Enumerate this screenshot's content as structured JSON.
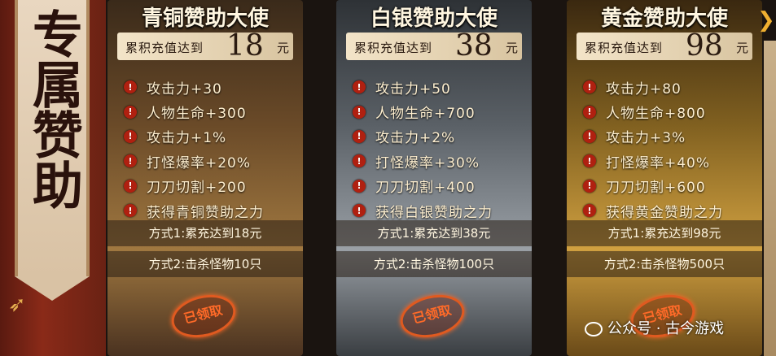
{
  "banner": {
    "title": "专属赞助"
  },
  "cards": [
    {
      "title": "青铜赞助大使",
      "price_label": "累积充值达到",
      "price_value": "18",
      "price_unit": "元",
      "perks": [
        "攻击力+30",
        "人物生命+300",
        "攻击力+1%",
        "打怪爆率+20%",
        "刀刀切割+200",
        "获得青铜赞助之力"
      ],
      "method1": "方式1:累充达到18元",
      "method2": "方式2:击杀怪物10只",
      "stamp": "已领取"
    },
    {
      "title": "白银赞助大使",
      "price_label": "累积充值达到",
      "price_value": "38",
      "price_unit": "元",
      "perks": [
        "攻击力+50",
        "人物生命+700",
        "攻击力+2%",
        "打怪爆率+30%",
        "刀刀切割+400",
        "获得白银赞助之力"
      ],
      "method1": "方式1:累充达到38元",
      "method2": "方式2:击杀怪物100只",
      "stamp": "已领取"
    },
    {
      "title": "黄金赞助大使",
      "price_label": "累积充值达到",
      "price_value": "98",
      "price_unit": "元",
      "perks": [
        "攻击力+80",
        "人物生命+800",
        "攻击力+3%",
        "打怪爆率+40%",
        "刀刀切割+600",
        "获得黄金赞助之力"
      ],
      "method1": "方式1:累充达到98元",
      "method2": "方式2:击杀怪物500只",
      "stamp": "已领取"
    }
  ],
  "nav": {
    "next_arrow_icon": "chevron-right-icon"
  },
  "watermark": {
    "text": "公众号 · 古今游戏"
  },
  "colors": {
    "bronze": "#a07840",
    "silver": "#9aa0a6",
    "gold": "#d0a040",
    "stamp": "#ff6a28"
  }
}
